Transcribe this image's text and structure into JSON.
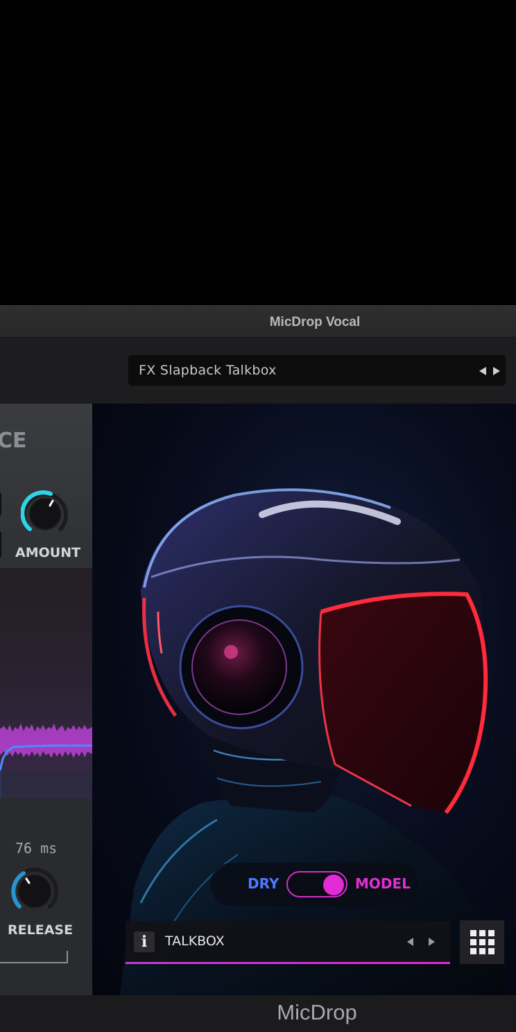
{
  "window": {
    "title": "MicDrop Vocal"
  },
  "toolbar": {
    "preset_name": "FX Slapback Talkbox"
  },
  "left_panel": {
    "section_title_fragment": "CE",
    "amount_label": "AMOUNT",
    "release_value": "76 ms",
    "release_label": "RELEASE"
  },
  "toggle": {
    "left_label": "DRY",
    "right_label": "MODEL",
    "state": "MODEL"
  },
  "model_selector": {
    "info_label": "i",
    "model_name": "TALKBOX"
  },
  "footer": {
    "brand": "MicDrop"
  },
  "colors": {
    "accent_pink": "#e02bd6",
    "accent_blue": "#4f78ff",
    "knob_teal": "#2ed3e6"
  },
  "icons": [
    "arrow-left-icon",
    "arrow-right-icon",
    "info-icon",
    "grid-icon"
  ]
}
